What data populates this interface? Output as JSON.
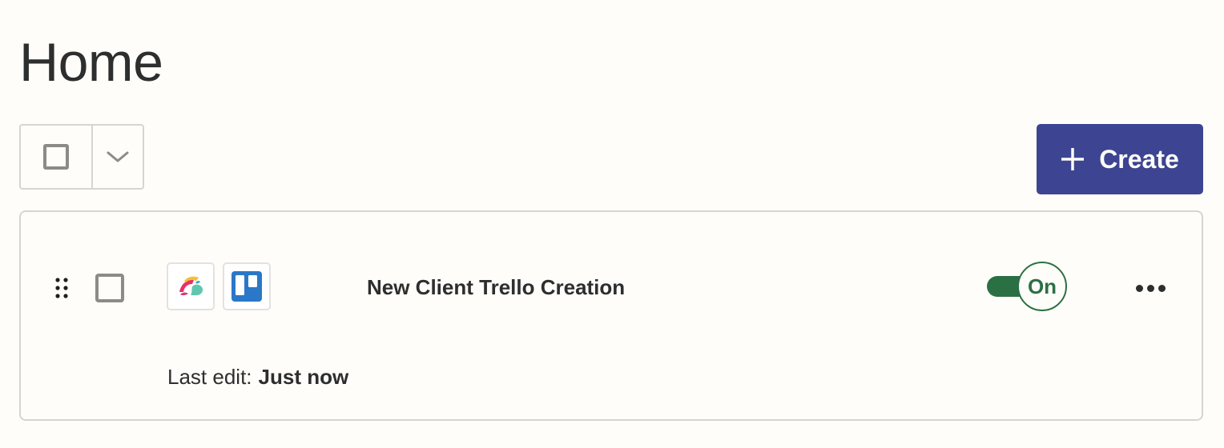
{
  "page": {
    "title": "Home"
  },
  "toolbar": {
    "select_all_icon": "checkbox-empty",
    "dropdown_icon": "chevron-down-icon",
    "create_label": "Create",
    "create_icon": "plus-icon"
  },
  "zaps": [
    {
      "title": "New Client Trello Creation",
      "apps": [
        "trigger-app-icon",
        "trello-icon"
      ],
      "status_label": "On",
      "status_on": true,
      "last_edit_label": "Last edit:",
      "last_edit_value": "Just now"
    }
  ],
  "colors": {
    "accent": "#3d4592",
    "toggle_on": "#2b7044",
    "background": "#fffdf9",
    "border": "#d6d5d2",
    "text": "#2d2e2e",
    "trello": "#2a78c7"
  }
}
